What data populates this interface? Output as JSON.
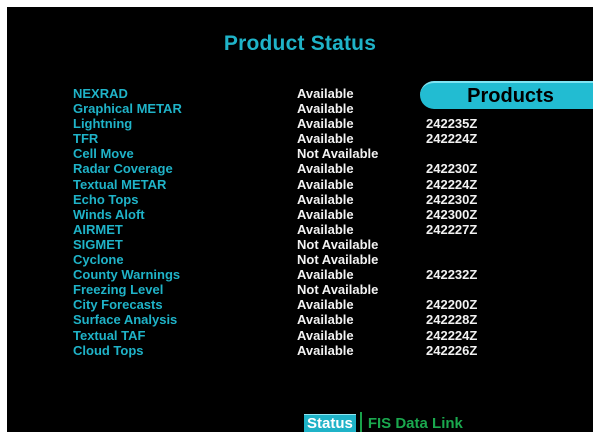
{
  "title": "Product Status",
  "products_button": "Products",
  "products": [
    {
      "name": "NEXRAD",
      "status": "Available",
      "time": ""
    },
    {
      "name": "Graphical METAR",
      "status": "Available",
      "time": ""
    },
    {
      "name": "Lightning",
      "status": "Available",
      "time": "242235Z"
    },
    {
      "name": "TFR",
      "status": "Available",
      "time": "242224Z"
    },
    {
      "name": "Cell Move",
      "status": "Not Available",
      "time": ""
    },
    {
      "name": "Radar Coverage",
      "status": "Available",
      "time": "242230Z"
    },
    {
      "name": "Textual METAR",
      "status": "Available",
      "time": "242224Z"
    },
    {
      "name": "Echo Tops",
      "status": "Available",
      "time": "242230Z"
    },
    {
      "name": "Winds Aloft",
      "status": "Available",
      "time": "242300Z"
    },
    {
      "name": "AIRMET",
      "status": "Available",
      "time": "242227Z"
    },
    {
      "name": "SIGMET",
      "status": "Not Available",
      "time": ""
    },
    {
      "name": "Cyclone",
      "status": "Not Available",
      "time": ""
    },
    {
      "name": "County Warnings",
      "status": "Available",
      "time": "242232Z"
    },
    {
      "name": "Freezing Level",
      "status": "Not Available",
      "time": ""
    },
    {
      "name": "City Forecasts",
      "status": "Available",
      "time": "242200Z"
    },
    {
      "name": "Surface Analysis",
      "status": "Available",
      "time": "242228Z"
    },
    {
      "name": "Textual TAF",
      "status": "Available",
      "time": "242224Z"
    },
    {
      "name": "Cloud Tops",
      "status": "Available",
      "time": "242226Z"
    }
  ],
  "tabs": {
    "status": "Status",
    "fis": "FIS Data Link"
  },
  "colors": {
    "accent": "#1fb3c8",
    "text": "#f2f2f2",
    "background": "#000000",
    "fis_green": "#1aa84e"
  }
}
